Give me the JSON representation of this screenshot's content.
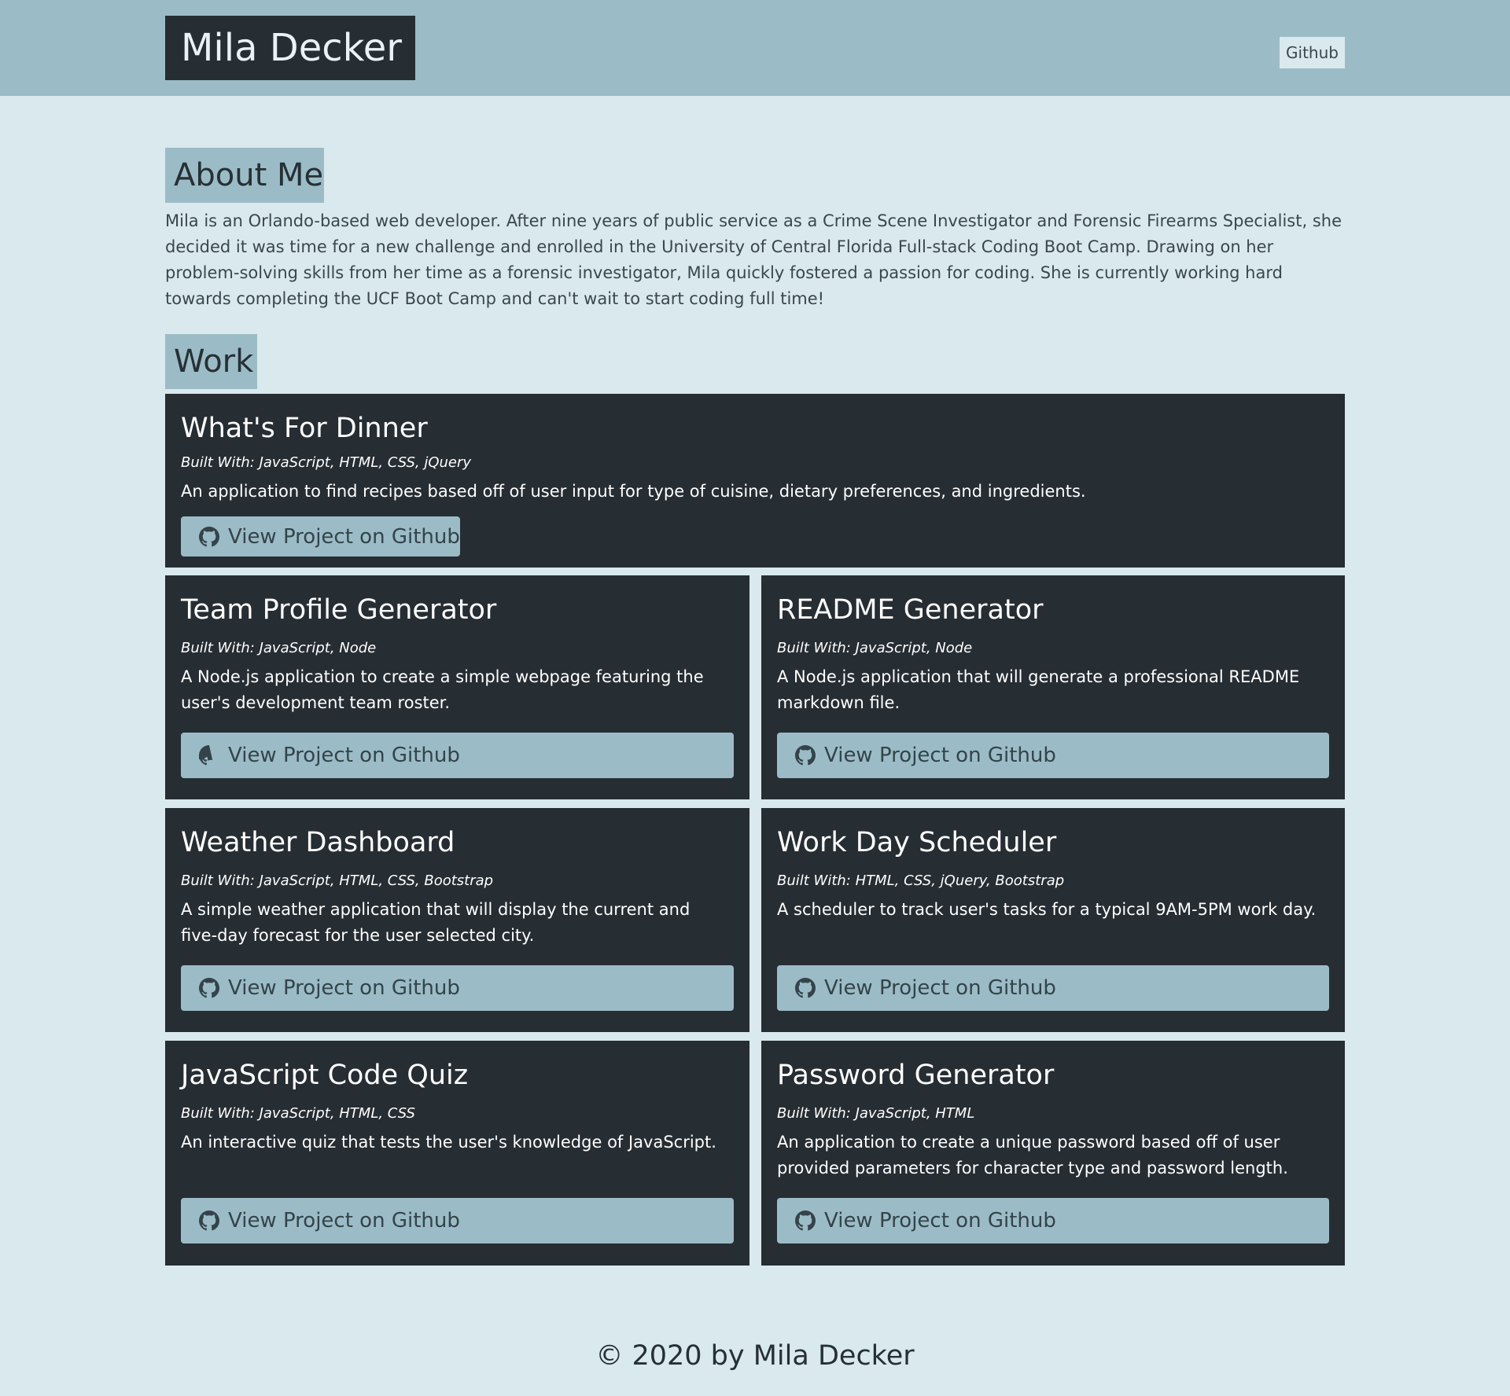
{
  "header": {
    "brand": "Mila Decker",
    "nav_github": "Github"
  },
  "about": {
    "title": "About Me",
    "text": "Mila is an Orlando-based web developer. After nine years of public service as a Crime Scene Investigator and Forensic Firearms Specialist, she decided it was time for a new challenge and enrolled in the University of Central Florida Full-stack Coding Boot Camp. Drawing on her problem-solving skills from her time as a forensic investigator, Mila quickly fostered a passion for coding. She is currently working hard towards completing the UCF Boot Camp and can't wait to start coding full time!"
  },
  "work": {
    "title": "Work",
    "projects": [
      {
        "title": "What's For Dinner",
        "built": "Built With: JavaScript, HTML, CSS, jQuery",
        "description": "An application to find recipes based off of user input for type of cuisine, dietary preferences, and ingredients.",
        "button": "View Project on Github",
        "icon": "github-icon"
      },
      {
        "title": "Team Profile Generator",
        "built": "Built With: JavaScript, Node",
        "description": "A Node.js application to create a simple webpage featuring the user's development team roster.",
        "button": "View Project on Github",
        "icon": "github-icon"
      },
      {
        "title": "README Generator",
        "built": "Built With: JavaScript, Node",
        "description": "A Node.js application that will generate a professional README markdown file.",
        "button": "View Project on Github",
        "icon": "github-icon"
      },
      {
        "title": "Weather Dashboard",
        "built": "Built With: JavaScript, HTML, CSS, Bootstrap",
        "description": "A simple weather application that will display the current and five-day forecast for the user selected city.",
        "button": "View Project on Github",
        "icon": "github-icon"
      },
      {
        "title": "Work Day Scheduler",
        "built": "Built With: HTML, CSS, jQuery, Bootstrap",
        "description": "A scheduler to track user's tasks for a typical 9AM-5PM work day.",
        "button": "View Project on Github",
        "icon": "github-icon"
      },
      {
        "title": "JavaScript Code Quiz",
        "built": "Built With: JavaScript, HTML, CSS",
        "description": "An interactive quiz that tests the user's knowledge of JavaScript.",
        "button": "View Project on Github",
        "icon": "github-icon"
      },
      {
        "title": "Password Generator",
        "built": "Built With: JavaScript, HTML",
        "description": "An application to create a unique password based off of user provided parameters for character type and password length.",
        "button": "View Project on Github",
        "icon": "github-icon"
      }
    ]
  },
  "footer": {
    "text": "© 2020 by Mila Decker"
  },
  "colors": {
    "header_bg": "#9bbcc6",
    "page_bg": "#dae9ee",
    "card_bg": "#262d33",
    "button_bg": "#9bbcc6"
  }
}
